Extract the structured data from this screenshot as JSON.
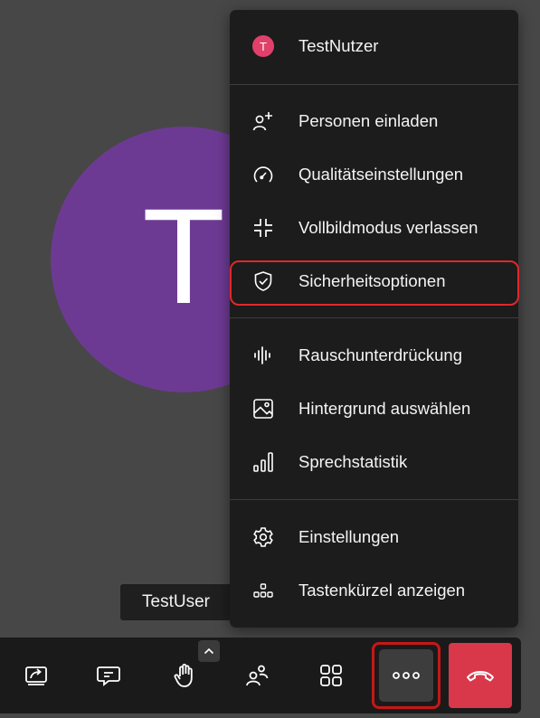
{
  "participant": {
    "avatar_initial": "T",
    "avatar_color": "#6d3a93",
    "name_tag": "TestUser"
  },
  "menu": {
    "user": {
      "initial": "T",
      "name": "TestNutzer",
      "badge_color": "#e0406a"
    },
    "groups": [
      [
        {
          "icon": "invite-person-icon",
          "label": "Personen einladen"
        },
        {
          "icon": "gauge-icon",
          "label": "Qualitätseinstellungen"
        },
        {
          "icon": "exit-fullscreen-icon",
          "label": "Vollbildmodus verlassen"
        },
        {
          "icon": "shield-icon",
          "label": "Sicherheitsoptionen",
          "highlighted": true
        }
      ],
      [
        {
          "icon": "noise-suppression-icon",
          "label": "Rauschunterdrückung"
        },
        {
          "icon": "image-icon",
          "label": "Hintergrund auswählen"
        },
        {
          "icon": "bar-chart-icon",
          "label": "Sprechstatistik"
        }
      ],
      [
        {
          "icon": "gear-icon",
          "label": "Einstellungen"
        },
        {
          "icon": "keyboard-shortcuts-icon",
          "label": "Tastenkürzel anzeigen"
        }
      ]
    ]
  },
  "toolbar": {
    "buttons": [
      {
        "icon": "share-screen-icon"
      },
      {
        "icon": "chat-icon"
      },
      {
        "icon": "raise-hand-icon"
      },
      {
        "icon": "participants-icon"
      },
      {
        "icon": "tile-view-icon"
      },
      {
        "icon": "more-options-icon",
        "active": true
      },
      {
        "icon": "hang-up-icon",
        "color": "#d9374a"
      }
    ]
  },
  "colors": {
    "background": "#474747",
    "menu_background": "#1c1c1c",
    "highlight_border": "#e02828"
  }
}
